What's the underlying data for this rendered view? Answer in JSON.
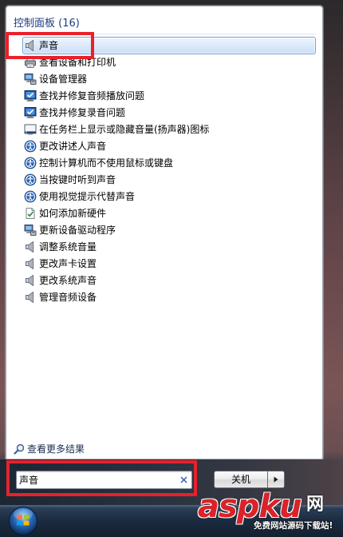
{
  "header": {
    "title": "控制面板 (16)"
  },
  "results": {
    "items": [
      {
        "label": "声音",
        "icon": "speaker-icon",
        "selected": true
      },
      {
        "label": "查看设备和打印机",
        "icon": "printer-icon"
      },
      {
        "label": "设备管理器",
        "icon": "device-manager-icon"
      },
      {
        "label": "查找并修复音频播放问题",
        "icon": "troubleshoot-icon"
      },
      {
        "label": "查找并修复录音问题",
        "icon": "troubleshoot-icon"
      },
      {
        "label": "在任务栏上显示或隐藏音量(扬声器)图标",
        "icon": "taskbar-icon"
      },
      {
        "label": "更改讲述人声音",
        "icon": "ease-of-access-icon"
      },
      {
        "label": "控制计算机而不使用鼠标或键盘",
        "icon": "ease-of-access-icon"
      },
      {
        "label": "当按键时听到声音",
        "icon": "ease-of-access-icon"
      },
      {
        "label": "使用视觉提示代替声音",
        "icon": "ease-of-access-icon"
      },
      {
        "label": "如何添加新硬件",
        "icon": "add-hardware-icon"
      },
      {
        "label": "更新设备驱动程序",
        "icon": "device-manager-icon"
      },
      {
        "label": "调整系统音量",
        "icon": "speaker-icon"
      },
      {
        "label": "更改声卡设置",
        "icon": "speaker-icon"
      },
      {
        "label": "更改系统声音",
        "icon": "speaker-icon"
      },
      {
        "label": "管理音频设备",
        "icon": "speaker-icon"
      }
    ]
  },
  "more_results": {
    "label": "查看更多结果",
    "icon": "search-icon"
  },
  "search": {
    "value": "声音",
    "clear_icon": "clear-icon"
  },
  "shutdown": {
    "label": "关机",
    "menu_icon": "triangle-right-icon"
  },
  "taskbar": {
    "start_icon": "windows-orb-icon"
  },
  "watermark": {
    "logo": "aspku",
    "logo_suffix": "网",
    "tagline": "免费网站源码下载站!"
  },
  "colors": {
    "header_text": "#1e3c80",
    "selection_border": "#7da2ce",
    "selection_fill": "#d9e9fb",
    "annotation_red": "#e8212a",
    "watermark_red": "#d9232a"
  }
}
